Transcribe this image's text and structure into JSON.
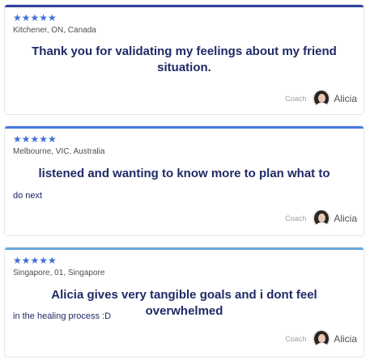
{
  "reviews": [
    {
      "stars": "★★★★★",
      "location": "Kitchener, ON, Canada",
      "quote_heading": "Thank you for validating my feelings about my friend situation.",
      "quote_continued": "",
      "coach_label": "Coach",
      "coach_name": "Alicia",
      "accent": "#2d3e9c"
    },
    {
      "stars": "★★★★★",
      "location": "Melbourne, VIC, Australia",
      "quote_heading": "listened and wanting to know more to plan what to",
      "quote_continued": "do next",
      "coach_label": "Coach",
      "coach_name": "Alicia",
      "accent": "#4a7be0"
    },
    {
      "stars": "★★★★★",
      "location": "Singapore, 01, Singapore",
      "quote_heading": "Alicia gives very tangible goals and i dont feel overwhelmed",
      "quote_continued": "in the healing process :D",
      "coach_label": "Coach",
      "coach_name": "Alicia",
      "accent": "#6aa9d8"
    }
  ]
}
